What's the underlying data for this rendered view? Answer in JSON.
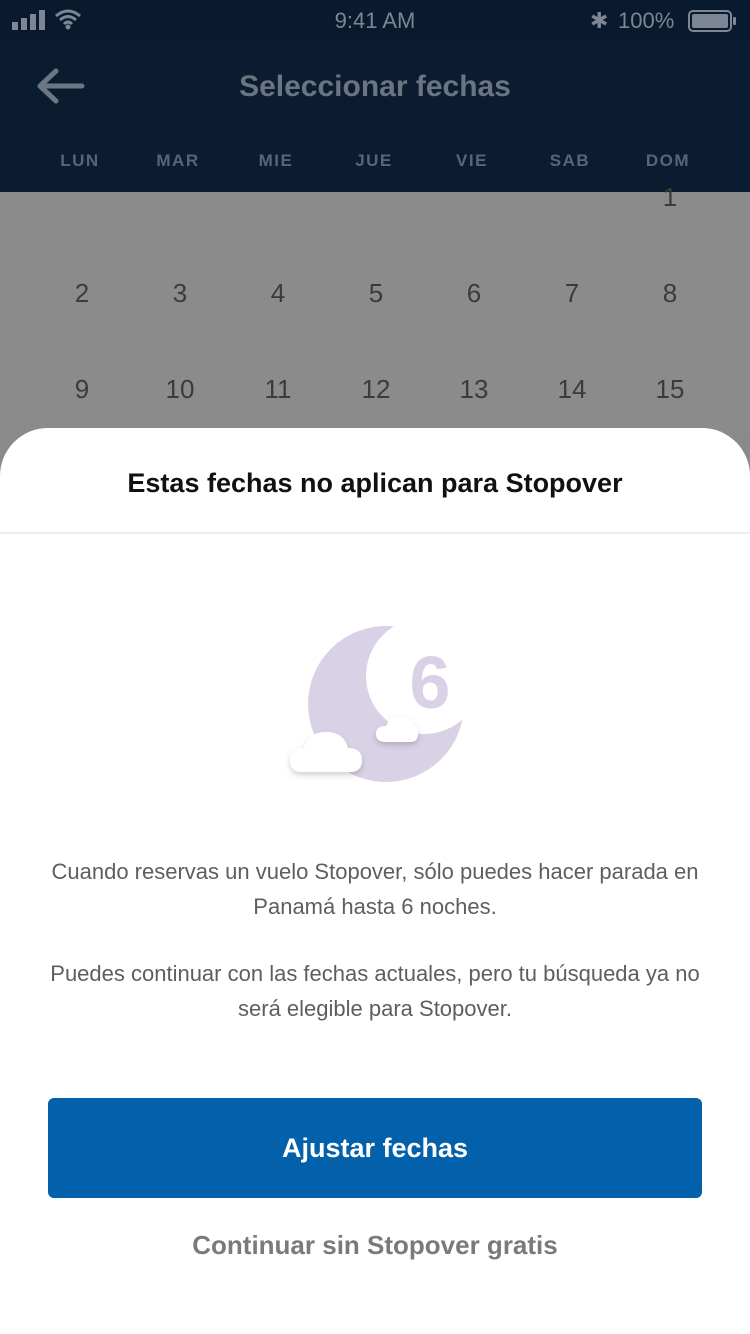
{
  "status_bar": {
    "time": "9:41 AM",
    "battery_percent": "100%",
    "icons": [
      "signal-icon",
      "wifi-icon",
      "bluetooth-icon",
      "battery-icon"
    ]
  },
  "header": {
    "title": "Seleccionar fechas",
    "back_icon": "arrow-left-icon"
  },
  "calendar": {
    "weekdays": [
      "LUN",
      "MAR",
      "MIE",
      "JUE",
      "VIE",
      "SAB",
      "DOM"
    ],
    "rows": [
      [
        "",
        "",
        "",
        "",
        "",
        "",
        "1"
      ],
      [
        "2",
        "3",
        "4",
        "5",
        "6",
        "7",
        "8"
      ],
      [
        "9",
        "10",
        "11",
        "12",
        "13",
        "14",
        "15"
      ]
    ]
  },
  "sheet": {
    "title": "Estas fechas no aplican para Stopover",
    "illustration": "moon-six-nights-icon",
    "illustration_number": "6",
    "message_1": "Cuando reservas un vuelo Stopover, sólo puedes hacer parada en Panamá hasta 6 noches.",
    "message_2": "Puedes continuar con las fechas actuales, pero tu búsqueda ya no será elegible para Stopover.",
    "primary_button": "Ajustar fechas",
    "secondary_button": "Continuar sin Stopover gratis"
  },
  "colors": {
    "nav_background": "#0b1c31",
    "primary_button": "#0360ab",
    "moon": "#d9d1e5",
    "overlay": "#8b8b8b"
  }
}
